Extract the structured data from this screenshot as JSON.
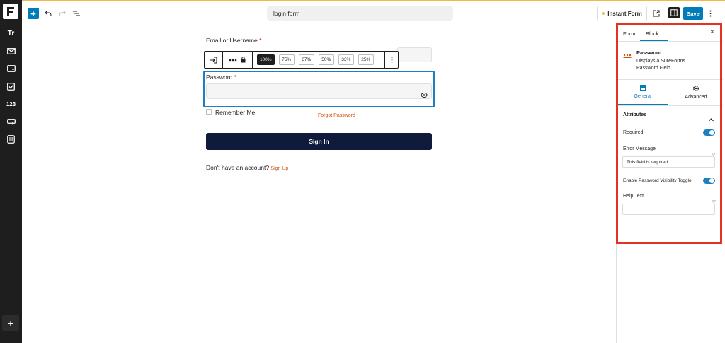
{
  "header": {
    "document_title": "login form",
    "instant_form_label": "Instant Form",
    "save_label": "Save"
  },
  "rail": {
    "items": [
      "Tr",
      "envelope",
      "input",
      "checkbox",
      "123",
      "button",
      "H"
    ],
    "numbers_label": "123",
    "heading_label": "H",
    "add_label": "+"
  },
  "form": {
    "email_label": "Email or Username",
    "required_mark": "*",
    "toolbar": {
      "widths": [
        "100%",
        "75%",
        "67%",
        "50%",
        "33%",
        "25%"
      ],
      "active_width": "100%"
    },
    "password_label": "Password",
    "remember_label": "Remember Me",
    "forgot_label": "Forgot Password",
    "signin_label": "Sign In",
    "account_prompt": "Don't have an account?",
    "signup_label": "Sign Up"
  },
  "sidebar": {
    "tabs": [
      "Form",
      "Block"
    ],
    "active_tab": "Block",
    "block_name": "Password",
    "block_desc_line1": "Displays a SureForms",
    "block_desc_line2": "Password Field",
    "subtabs": [
      "General",
      "Advanced"
    ],
    "section_title": "Attributes",
    "required_label": "Required",
    "required_on": true,
    "error_message_label": "Error Message",
    "error_message_value": "This field is required.",
    "visibility_toggle_label": "Enable Password Visibility Toggle",
    "visibility_on": true,
    "help_text_label": "Help Text"
  },
  "colors": {
    "accent": "#007cba",
    "selection": "#1d7fc1",
    "link": "#cc5217",
    "signin_bg": "#101a3b",
    "highlight_frame": "#e53120"
  }
}
